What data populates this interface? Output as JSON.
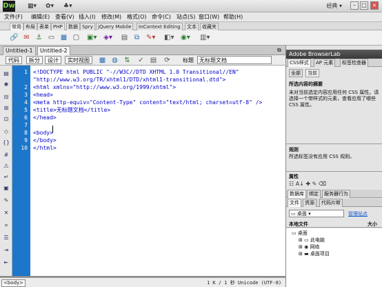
{
  "app": {
    "logo": "Dw",
    "profile": "经典 ▾",
    "win_min": "–",
    "win_max": "□",
    "win_close": "×"
  },
  "menu": [
    "文件(F)",
    "编辑(E)",
    "查看(V)",
    "插入(I)",
    "修改(M)",
    "格式(O)",
    "命令(C)",
    "站点(S)",
    "窗口(W)",
    "帮助(H)"
  ],
  "insert_tabs": [
    "常用",
    "布局",
    "表单",
    "PHP",
    "数据",
    "Spry",
    "jQuery Mobile",
    "InContext Editing",
    "文本",
    "收藏夹"
  ],
  "doc_tabs": [
    "Untitled-1",
    "Untitled-2"
  ],
  "view_buttons": [
    "代码",
    "拆分",
    "设计",
    "实时视图"
  ],
  "title_label": "标题",
  "title_value": "无标题文档",
  "code_lines": [
    "<!DOCTYPE html PUBLIC \"-//W3C//DTD XHTML 1.0 Transitional//EN\"",
    "\"http://www.w3.org/TR/xhtml1/DTD/xhtml1-transitional.dtd\">",
    "<html xmlns=\"http://www.w3.org/1999/xhtml\">",
    "<head>",
    "<meta http-equiv=\"Content-Type\" content=\"text/html; charset=utf-8\" />",
    "<title>无标题文档</title>",
    "</head>",
    "",
    "<body>",
    "</body>",
    "</html>"
  ],
  "line_numbers": [
    "1",
    "",
    "2",
    "3",
    "4",
    "5",
    "6",
    "7",
    "8",
    "9",
    "10"
  ],
  "status": {
    "tag": "<body>",
    "info": "1 K / 1 秒  Unicode (UTF-8)",
    "props": "属性"
  },
  "panels": {
    "browserlab": "Adobe BrowserLab",
    "css_tabs": [
      "CSS样式",
      "AP 元素",
      "标签检查器"
    ],
    "css_sub": [
      "全部",
      "当前"
    ],
    "summary_title": "所选内容的摘要",
    "summary_text": "未对当前选定内容应用任何 CSS 属性。请选择一个带样式的元素，查看应用了哪些 CSS 属性。",
    "rules_title": "规则",
    "rules_text": "所选标签没有应用 CSS 规则。",
    "props_title": "属性",
    "file_tabs1": [
      "数据库",
      "绑定",
      "服务器行为"
    ],
    "file_tabs2": [
      "文件",
      "资源",
      "代码片断"
    ],
    "site_select": "桌面",
    "manage_sites": "管理站点",
    "col_local": "本地文件",
    "col_size": "大小",
    "tree": [
      "桌面",
      "此电脑",
      "网络",
      "桌面项目"
    ]
  }
}
